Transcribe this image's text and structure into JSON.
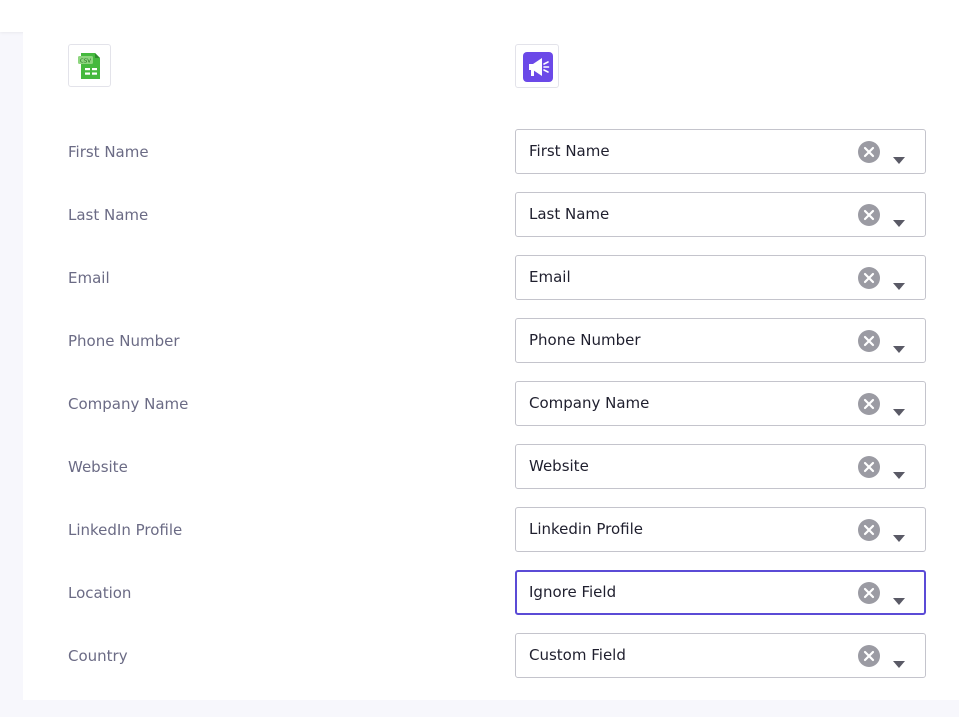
{
  "source": {
    "icon": "csv-file-icon",
    "badge_text": "CSV"
  },
  "destination": {
    "icon": "megaphone-app-icon",
    "accent": "#6b49e8"
  },
  "colors": {
    "csv_green": "#3fb93f",
    "focus": "#5b4bd6",
    "clear_grey": "#9b9ba3"
  },
  "rows": [
    {
      "label": "First Name",
      "value": "First Name"
    },
    {
      "label": "Last Name",
      "value": "Last Name"
    },
    {
      "label": "Email",
      "value": "Email"
    },
    {
      "label": "Phone Number",
      "value": "Phone Number"
    },
    {
      "label": "Company Name",
      "value": "Company Name"
    },
    {
      "label": "Website",
      "value": "Website"
    },
    {
      "label": "LinkedIn Profile",
      "value": "Linkedin Profile"
    },
    {
      "label": "Location",
      "value": "Ignore Field"
    },
    {
      "label": "Country",
      "value": "Custom Field"
    }
  ]
}
